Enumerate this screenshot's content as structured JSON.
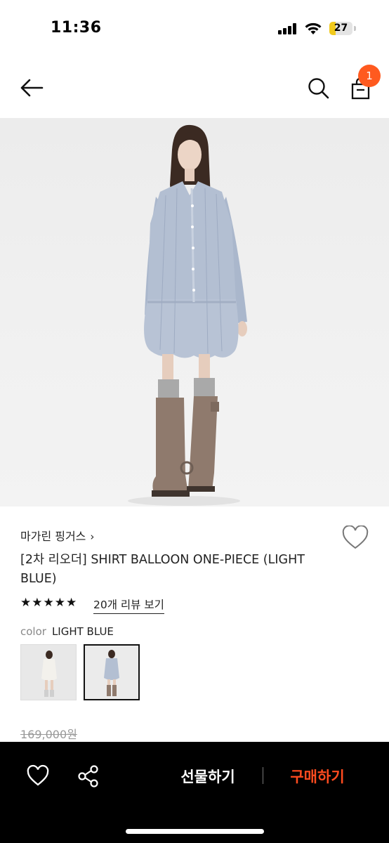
{
  "status_bar": {
    "time": "11:36",
    "battery": "27",
    "battery_level": 0.27
  },
  "nav": {
    "cart_count": "1"
  },
  "product": {
    "brand": "마가린 핑거스",
    "brand_chevron": "›",
    "title": "[2차 리오더] SHIRT BALLOON ONE-PIECE (LIGHT BLUE)",
    "rating_stars": "★★★★★",
    "review_link": "20개 리뷰 보기",
    "color_label": "color",
    "color_value": "LIGHT BLUE",
    "original_price": "169,000원"
  },
  "bottom_bar": {
    "gift_label": "선물하기",
    "buy_label": "구매하기"
  },
  "colors": {
    "accent": "#ff5a1f",
    "buy": "#ff4b1f",
    "bar_bg": "#000000"
  }
}
